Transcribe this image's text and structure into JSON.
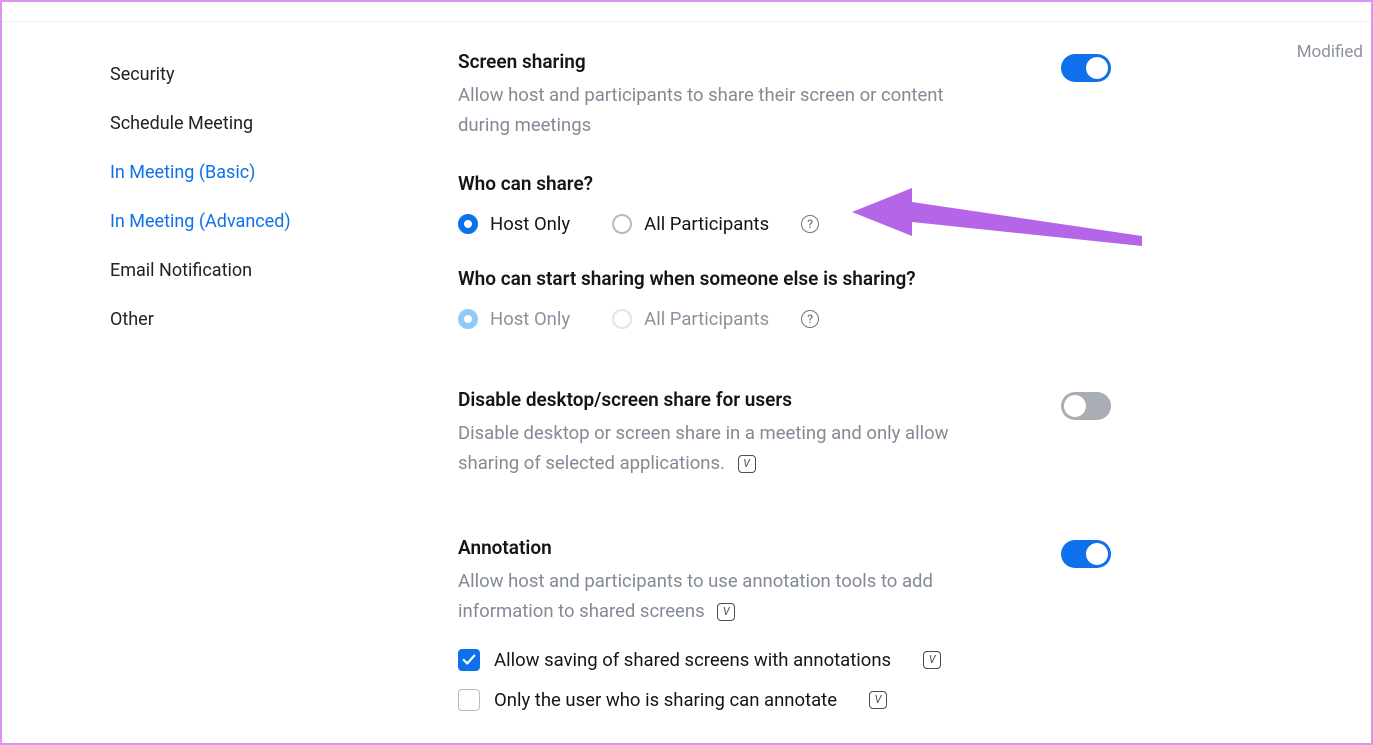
{
  "sidebar": {
    "items": [
      {
        "label": "Security",
        "active": false
      },
      {
        "label": "Schedule Meeting",
        "active": false
      },
      {
        "label": "In Meeting (Basic)",
        "active": true
      },
      {
        "label": "In Meeting (Advanced)",
        "active": true
      },
      {
        "label": "Email Notification",
        "active": false
      },
      {
        "label": "Other",
        "active": false
      }
    ]
  },
  "modified_label": "Modified",
  "settings": {
    "screen_sharing": {
      "title": "Screen sharing",
      "desc": "Allow host and participants to share their screen or content during meetings",
      "q1": "Who can share?",
      "q1_options": {
        "a": "Host Only",
        "b": "All Participants"
      },
      "q2": "Who can start sharing when someone else is sharing?",
      "q2_options": {
        "a": "Host Only",
        "b": "All Participants"
      }
    },
    "disable_desktop": {
      "title": "Disable desktop/screen share for users",
      "desc": "Disable desktop or screen share in a meeting and only allow sharing of selected applications."
    },
    "annotation": {
      "title": "Annotation",
      "desc": "Allow host and participants to use annotation tools to add information to shared screens",
      "check1": "Allow saving of shared screens with annotations",
      "check2": "Only the user who is sharing can annotate"
    }
  }
}
